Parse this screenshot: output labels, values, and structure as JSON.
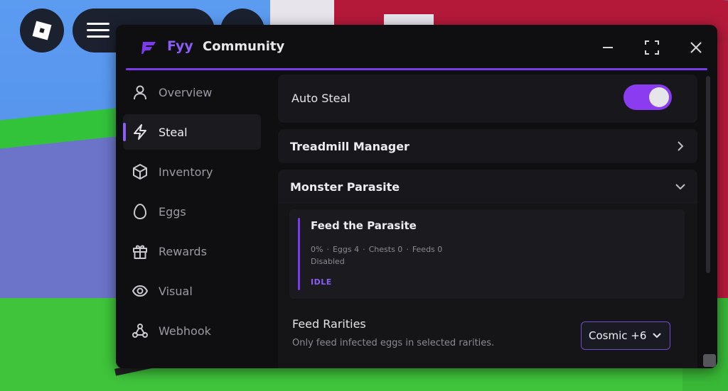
{
  "window": {
    "brand": "Fyy",
    "title": "Community",
    "minimize_icon": "minimize-icon",
    "maximize_icon": "maximize-icon",
    "close_icon": "close-icon",
    "accent_color": "#7c3aed"
  },
  "sidebar": {
    "items": [
      {
        "label": "Overview",
        "icon": "user-icon",
        "active": false
      },
      {
        "label": "Steal",
        "icon": "lightning-icon",
        "active": true
      },
      {
        "label": "Inventory",
        "icon": "box-icon",
        "active": false
      },
      {
        "label": "Eggs",
        "icon": "egg-icon",
        "active": false
      },
      {
        "label": "Rewards",
        "icon": "gift-icon",
        "active": false
      },
      {
        "label": "Visual",
        "icon": "eye-icon",
        "active": false
      },
      {
        "label": "Webhook",
        "icon": "webhook-icon",
        "active": false
      }
    ]
  },
  "main": {
    "auto_steal": {
      "label": "Auto Steal",
      "enabled": true
    },
    "treadmill": {
      "title": "Treadmill Manager",
      "icon": "chevron-right-icon"
    },
    "monster": {
      "title": "Monster Parasite",
      "icon": "chevron-down-icon",
      "feed": {
        "title": "Feed the Parasite",
        "progress": "0%",
        "eggs": "Eggs 4",
        "chests": "Chests 0",
        "feeds": "Feeds 0",
        "separator": "·",
        "status": "Disabled",
        "state": "IDLE"
      },
      "rarities": {
        "label": "Feed Rarities",
        "description": "Only feed infected eggs in selected rarities.",
        "selected": "Cosmic +6"
      }
    }
  }
}
